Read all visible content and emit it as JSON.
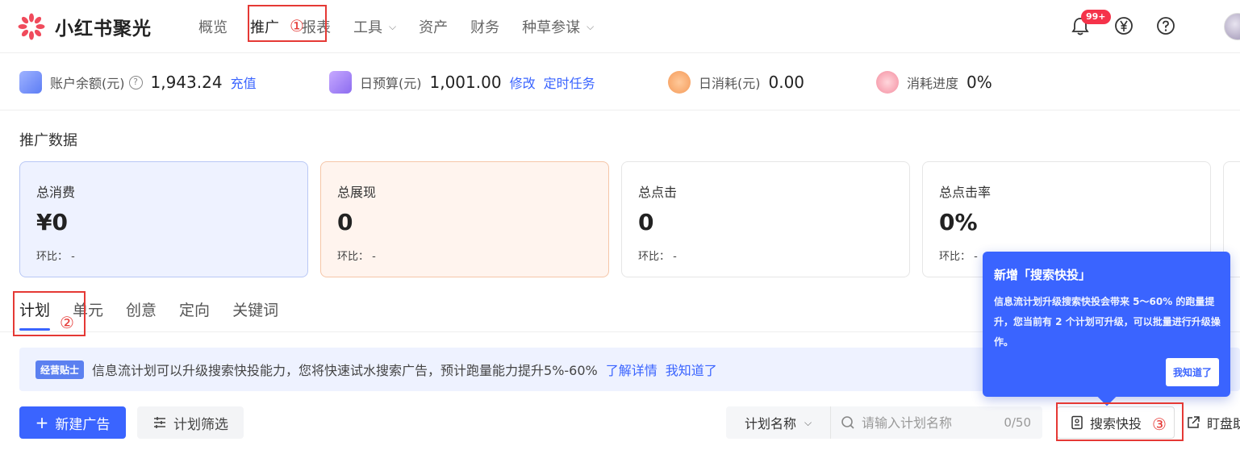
{
  "header": {
    "brand": "小红书聚光",
    "nav": [
      {
        "label": "概览"
      },
      {
        "label": "推广",
        "active": true
      },
      {
        "label": "报表"
      },
      {
        "label": "工具",
        "dropdown": true
      },
      {
        "label": "资产"
      },
      {
        "label": "财务"
      },
      {
        "label": "种草参谋",
        "dropdown": true
      }
    ],
    "notification_badge": "99+",
    "icons": [
      "bell-icon",
      "yen-icon",
      "help-icon",
      "avatar"
    ]
  },
  "metrics": {
    "balance": {
      "label": "账户余额(元)",
      "value": "1,943.24",
      "link": "充值"
    },
    "budget": {
      "label": "日预算(元)",
      "value": "1,001.00",
      "link1": "修改",
      "link2": "定时任务"
    },
    "spend": {
      "label": "日消耗(元)",
      "value": "0.00"
    },
    "progress": {
      "label": "消耗进度",
      "value": "0%"
    }
  },
  "section": {
    "title": "推广数据"
  },
  "cards": [
    {
      "title": "总消费",
      "value": "¥0",
      "ratio": "环比： -"
    },
    {
      "title": "总展现",
      "value": "0",
      "ratio": "环比： -"
    },
    {
      "title": "总点击",
      "value": "0",
      "ratio": "环比： -"
    },
    {
      "title": "总点击率",
      "value": "0%",
      "ratio": "环比： -"
    }
  ],
  "tabs": [
    {
      "label": "计划",
      "active": true
    },
    {
      "label": "单元"
    },
    {
      "label": "创意"
    },
    {
      "label": "定向"
    },
    {
      "label": "关键词"
    }
  ],
  "tip": {
    "tag": "经营贴士",
    "text": "信息流计划可以升级搜索快投能力，您将快速试水搜索广告，预计跑量能力提升5%-60%",
    "link1": "了解详情",
    "link2": "我知道了"
  },
  "toolbar": {
    "new_ad": "新建广告",
    "filter": "计划筛选",
    "select_value": "计划名称",
    "search_placeholder": "请输入计划名称",
    "counter": "0/50",
    "quick_search": "搜索快投",
    "watch": "盯盘助"
  },
  "popover": {
    "title": "新增「搜索快投」",
    "body": "信息流计划升级搜索快投会带来 5～60% 的跑量提升，您当前有 2 个计划可升级，可以批量进行升级操作。",
    "button": "我知道了"
  },
  "annotations": [
    "①",
    "②",
    "③"
  ],
  "colors": {
    "accent": "#3a64ff",
    "annotation": "#e53935",
    "badge": "#f5334a"
  }
}
